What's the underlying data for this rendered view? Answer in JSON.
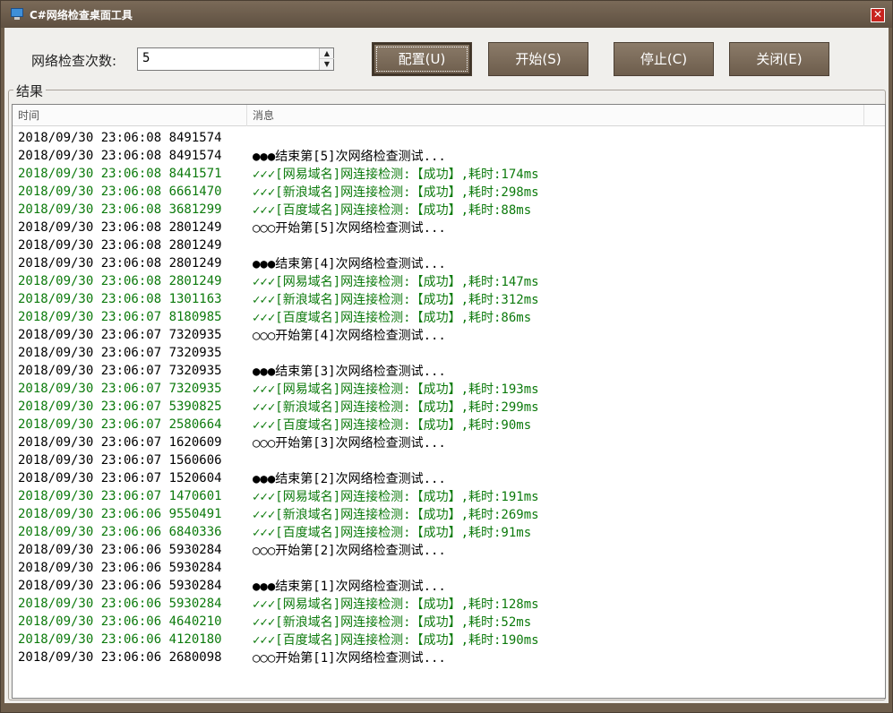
{
  "window": {
    "title": "C#网络检查桌面工具",
    "close_label": "✕",
    "colors": {
      "chrome": "#6e5e4c",
      "ok_text": "#0c7a0c",
      "normal_text": "#000000"
    }
  },
  "controls": {
    "count_label": "网络检查次数:",
    "count_value": "5",
    "spin_up": "▲",
    "spin_down": "▼",
    "buttons": {
      "config": "配置(U)",
      "start": "开始(S)",
      "stop": "停止(C)",
      "close": "关闭(E)"
    }
  },
  "results": {
    "group_label": "结果",
    "columns": {
      "time": "时间",
      "message": "消息"
    },
    "rows": [
      {
        "time": "2018/09/30 23:06:08 8491574",
        "msg": "",
        "color": "black"
      },
      {
        "time": "2018/09/30 23:06:08 8491574",
        "msg": "●●●结束第[5]次网络检查测试...",
        "color": "black"
      },
      {
        "time": "2018/09/30 23:06:08 8441571",
        "msg": "✓✓✓[网易域名]网连接检测:【成功】,耗时:174ms",
        "color": "green"
      },
      {
        "time": "2018/09/30 23:06:08 6661470",
        "msg": "✓✓✓[新浪域名]网连接检测:【成功】,耗时:298ms",
        "color": "green"
      },
      {
        "time": "2018/09/30 23:06:08 3681299",
        "msg": "✓✓✓[百度域名]网连接检测:【成功】,耗时:88ms",
        "color": "green"
      },
      {
        "time": "2018/09/30 23:06:08 2801249",
        "msg": "○○○开始第[5]次网络检查测试...",
        "color": "black"
      },
      {
        "time": "2018/09/30 23:06:08 2801249",
        "msg": "",
        "color": "black"
      },
      {
        "time": "2018/09/30 23:06:08 2801249",
        "msg": "●●●结束第[4]次网络检查测试...",
        "color": "black"
      },
      {
        "time": "2018/09/30 23:06:08 2801249",
        "msg": "✓✓✓[网易域名]网连接检测:【成功】,耗时:147ms",
        "color": "green"
      },
      {
        "time": "2018/09/30 23:06:08 1301163",
        "msg": "✓✓✓[新浪域名]网连接检测:【成功】,耗时:312ms",
        "color": "green"
      },
      {
        "time": "2018/09/30 23:06:07 8180985",
        "msg": "✓✓✓[百度域名]网连接检测:【成功】,耗时:86ms",
        "color": "green"
      },
      {
        "time": "2018/09/30 23:06:07 7320935",
        "msg": "○○○开始第[4]次网络检查测试...",
        "color": "black"
      },
      {
        "time": "2018/09/30 23:06:07 7320935",
        "msg": "",
        "color": "black"
      },
      {
        "time": "2018/09/30 23:06:07 7320935",
        "msg": "●●●结束第[3]次网络检查测试...",
        "color": "black"
      },
      {
        "time": "2018/09/30 23:06:07 7320935",
        "msg": "✓✓✓[网易域名]网连接检测:【成功】,耗时:193ms",
        "color": "green"
      },
      {
        "time": "2018/09/30 23:06:07 5390825",
        "msg": "✓✓✓[新浪域名]网连接检测:【成功】,耗时:299ms",
        "color": "green"
      },
      {
        "time": "2018/09/30 23:06:07 2580664",
        "msg": "✓✓✓[百度域名]网连接检测:【成功】,耗时:90ms",
        "color": "green"
      },
      {
        "time": "2018/09/30 23:06:07 1620609",
        "msg": "○○○开始第[3]次网络检查测试...",
        "color": "black"
      },
      {
        "time": "2018/09/30 23:06:07 1560606",
        "msg": "",
        "color": "black"
      },
      {
        "time": "2018/09/30 23:06:07 1520604",
        "msg": "●●●结束第[2]次网络检查测试...",
        "color": "black"
      },
      {
        "time": "2018/09/30 23:06:07 1470601",
        "msg": "✓✓✓[网易域名]网连接检测:【成功】,耗时:191ms",
        "color": "green"
      },
      {
        "time": "2018/09/30 23:06:06 9550491",
        "msg": "✓✓✓[新浪域名]网连接检测:【成功】,耗时:269ms",
        "color": "green"
      },
      {
        "time": "2018/09/30 23:06:06 6840336",
        "msg": "✓✓✓[百度域名]网连接检测:【成功】,耗时:91ms",
        "color": "green"
      },
      {
        "time": "2018/09/30 23:06:06 5930284",
        "msg": "○○○开始第[2]次网络检查测试...",
        "color": "black"
      },
      {
        "time": "2018/09/30 23:06:06 5930284",
        "msg": "",
        "color": "black"
      },
      {
        "time": "2018/09/30 23:06:06 5930284",
        "msg": "●●●结束第[1]次网络检查测试...",
        "color": "black"
      },
      {
        "time": "2018/09/30 23:06:06 5930284",
        "msg": "✓✓✓[网易域名]网连接检测:【成功】,耗时:128ms",
        "color": "green"
      },
      {
        "time": "2018/09/30 23:06:06 4640210",
        "msg": "✓✓✓[新浪域名]网连接检测:【成功】,耗时:52ms",
        "color": "green"
      },
      {
        "time": "2018/09/30 23:06:06 4120180",
        "msg": "✓✓✓[百度域名]网连接检测:【成功】,耗时:190ms",
        "color": "green"
      },
      {
        "time": "2018/09/30 23:06:06 2680098",
        "msg": "○○○开始第[1]次网络检查测试...",
        "color": "black"
      }
    ]
  }
}
